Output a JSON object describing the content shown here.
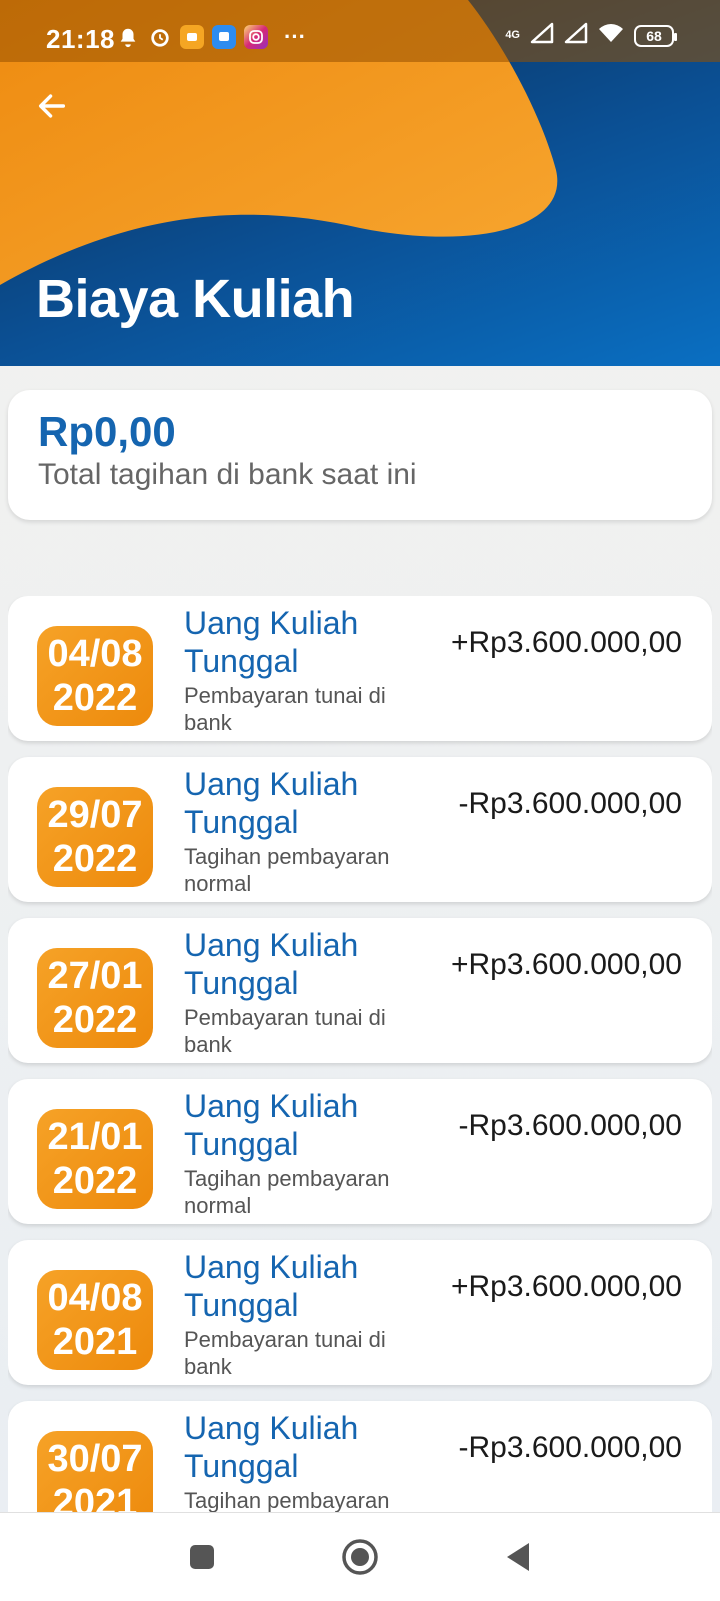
{
  "status_bar": {
    "time": "21:18",
    "network": "4G",
    "battery": "68",
    "more": "···"
  },
  "header": {
    "title": "Biaya Kuliah",
    "back_icon": "arrow-left-icon",
    "colors": {
      "orange": "#f5a026",
      "blue": "#0b6ec2",
      "navy": "#0c2a4d"
    }
  },
  "summary": {
    "amount": "Rp0,00",
    "label": "Total tagihan di bank saat ini"
  },
  "transactions": [
    {
      "date_dm": "04/08",
      "date_y": "2022",
      "title": "Uang Kuliah Tunggal",
      "subtitle": "Pembayaran tunai di bank",
      "amount": "+Rp3.600.000,00"
    },
    {
      "date_dm": "29/07",
      "date_y": "2022",
      "title": "Uang Kuliah Tunggal",
      "subtitle": "Tagihan pembayaran normal",
      "amount": "-Rp3.600.000,00"
    },
    {
      "date_dm": "27/01",
      "date_y": "2022",
      "title": "Uang Kuliah Tunggal",
      "subtitle": "Pembayaran tunai di bank",
      "amount": "+Rp3.600.000,00"
    },
    {
      "date_dm": "21/01",
      "date_y": "2022",
      "title": "Uang Kuliah Tunggal",
      "subtitle": "Tagihan pembayaran normal",
      "amount": "-Rp3.600.000,00"
    },
    {
      "date_dm": "04/08",
      "date_y": "2021",
      "title": "Uang Kuliah Tunggal",
      "subtitle": "Pembayaran tunai di bank",
      "amount": "+Rp3.600.000,00"
    },
    {
      "date_dm": "30/07",
      "date_y": "2021",
      "title": "Uang Kuliah Tunggal",
      "subtitle": "Tagihan pembayaran normal",
      "amount": "-Rp3.600.000,00"
    }
  ],
  "nav": {
    "recents_icon": "square-icon",
    "home_icon": "circle-icon",
    "back_icon": "triangle-back-icon"
  }
}
